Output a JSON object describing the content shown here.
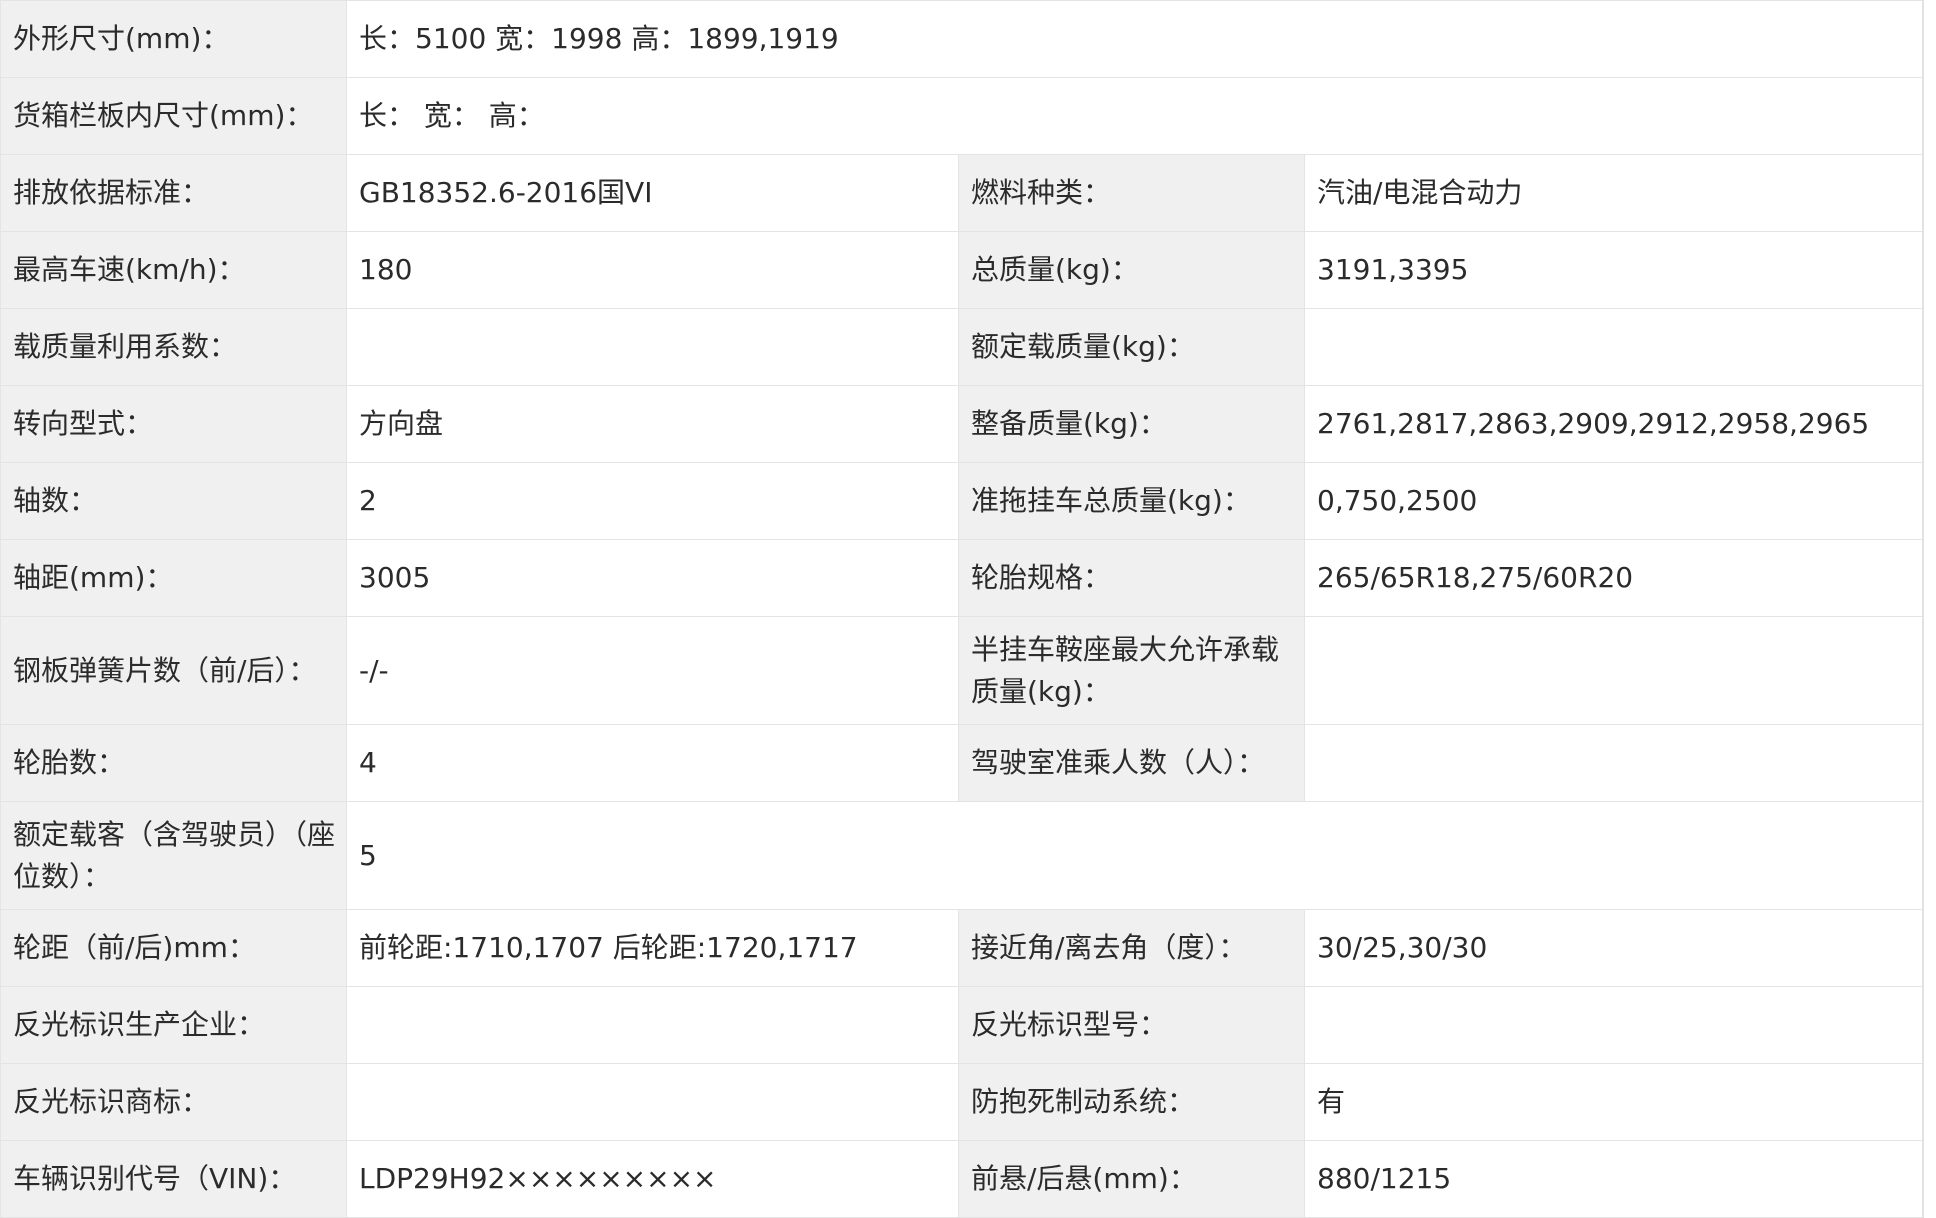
{
  "rows": [
    {
      "k1": "外形尺寸(mm)：",
      "v1": "长：5100 宽：1998 高：1899,1919",
      "span": true
    },
    {
      "k1": "货箱栏板内尺寸(mm)：",
      "v1": "长：  宽：  高：",
      "span": true
    },
    {
      "k1": "排放依据标准：",
      "v1": "GB18352.6-2016国VI",
      "k2": "燃料种类：",
      "v2": "汽油/电混合动力"
    },
    {
      "k1": "最高车速(km/h)：",
      "v1": "180",
      "k2": "总质量(kg)：",
      "v2": "3191,3395"
    },
    {
      "k1": "载质量利用系数：",
      "v1": "",
      "k2": "额定载质量(kg)：",
      "v2": ""
    },
    {
      "k1": "转向型式：",
      "v1": "方向盘",
      "k2": "整备质量(kg)：",
      "v2": "2761,2817,2863,2909,2912,2958,2965"
    },
    {
      "k1": "轴数：",
      "v1": "2",
      "k2": "准拖挂车总质量(kg)：",
      "v2": "0,750,2500"
    },
    {
      "k1": "轴距(mm)：",
      "v1": "3005",
      "k2": "轮胎规格：",
      "v2": "265/65R18,275/60R20"
    },
    {
      "k1": "钢板弹簧片数（前/后）：",
      "v1": "-/-",
      "k2": "半挂车鞍座最大允许承载质量(kg)：",
      "v2": ""
    },
    {
      "k1": "轮胎数：",
      "v1": "4",
      "k2": "驾驶室准乘人数（人）：",
      "v2": ""
    },
    {
      "k1": "额定载客（含驾驶员）（座位数）：",
      "v1": "5",
      "span": true
    },
    {
      "k1": "轮距（前/后)mm：",
      "v1": "前轮距:1710,1707 后轮距:1720,1717",
      "k2": "接近角/离去角（度）：",
      "v2": "30/25,30/30"
    },
    {
      "k1": "反光标识生产企业：",
      "v1": "",
      "k2": "反光标识型号：",
      "v2": ""
    },
    {
      "k1": "反光标识商标：",
      "v1": "",
      "k2": "防抱死制动系统：",
      "v2": "有"
    },
    {
      "k1": "车辆识别代号（VIN)：",
      "v1": "LDP29H92×××××××××",
      "k2": "前悬/后悬(mm)：",
      "v2": "880/1215"
    }
  ]
}
